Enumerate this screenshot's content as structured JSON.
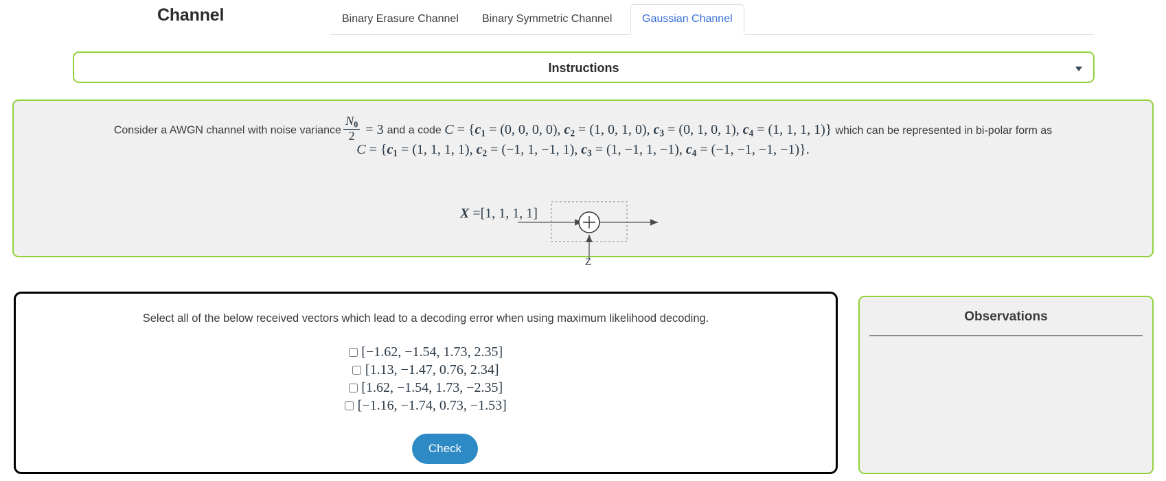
{
  "header": {
    "app_title": "Channel",
    "tabs": [
      {
        "label": "Binary Erasure Channel",
        "active": false
      },
      {
        "label": "Binary Symmetric Channel",
        "active": false
      },
      {
        "label": "Gaussian Channel",
        "active": true
      }
    ]
  },
  "instructions": {
    "label": "Instructions",
    "caret_icon": "chevron-down-icon",
    "expanded": false
  },
  "problem": {
    "lead_text": "Consider a AWGN channel with noise variance",
    "noise_numerator": "N",
    "noise_numerator_sub": "0",
    "noise_denominator": "2",
    "equals": "=",
    "noise_value": "3",
    "mid_text": "and a code",
    "code_symbol": "C",
    "codewords_binary": [
      {
        "name": "c",
        "sub": "1",
        "value": "(0, 0, 0, 0)"
      },
      {
        "name": "c",
        "sub": "2",
        "value": "(1, 0, 1, 0)"
      },
      {
        "name": "c",
        "sub": "3",
        "value": "(0, 1, 0, 1)"
      },
      {
        "name": "c",
        "sub": "4",
        "value": "(1, 1, 1, 1)"
      }
    ],
    "tail_text": "which can be represented in bi-polar form as",
    "codewords_bipolar": [
      {
        "name": "c",
        "sub": "1",
        "value": "(1, 1, 1, 1)"
      },
      {
        "name": "c",
        "sub": "2",
        "value": "(−1, 1, −1, 1)"
      },
      {
        "name": "c",
        "sub": "3",
        "value": "(1, −1, 1, −1)"
      },
      {
        "name": "c",
        "sub": "4",
        "value": "(−1, −1, −1, −1)"
      }
    ],
    "bipolar_suffix": "."
  },
  "diagram": {
    "input_label": "X",
    "input_equals": "=",
    "input_vector": "[1, 1, 1, 1]",
    "noise_label": "Z",
    "adder_icon": "circled-plus-icon"
  },
  "question": {
    "prompt": "Select all of the below received vectors which lead to a decoding error when using maximum likelihood decoding.",
    "options": [
      {
        "id": "opt1",
        "label": "[−1.62, −1.54, 1.73, 2.35]",
        "checked": false
      },
      {
        "id": "opt2",
        "label": "[1.13, −1.47, 0.76, 2.34]",
        "checked": false
      },
      {
        "id": "opt3",
        "label": "[1.62, −1.54, 1.73, −2.35]",
        "checked": false
      },
      {
        "id": "opt4",
        "label": "[−1.16, −1.74, 0.73, −1.53]",
        "checked": false
      }
    ],
    "check_label": "Check"
  },
  "observations": {
    "title": "Observations",
    "body": ""
  },
  "colors": {
    "green_border": "#92d13d",
    "panel_background": "#f0f0f0",
    "active_tab_text": "#3a6fd8",
    "check_button": "#2e8ac4",
    "question_border": "#000000"
  }
}
